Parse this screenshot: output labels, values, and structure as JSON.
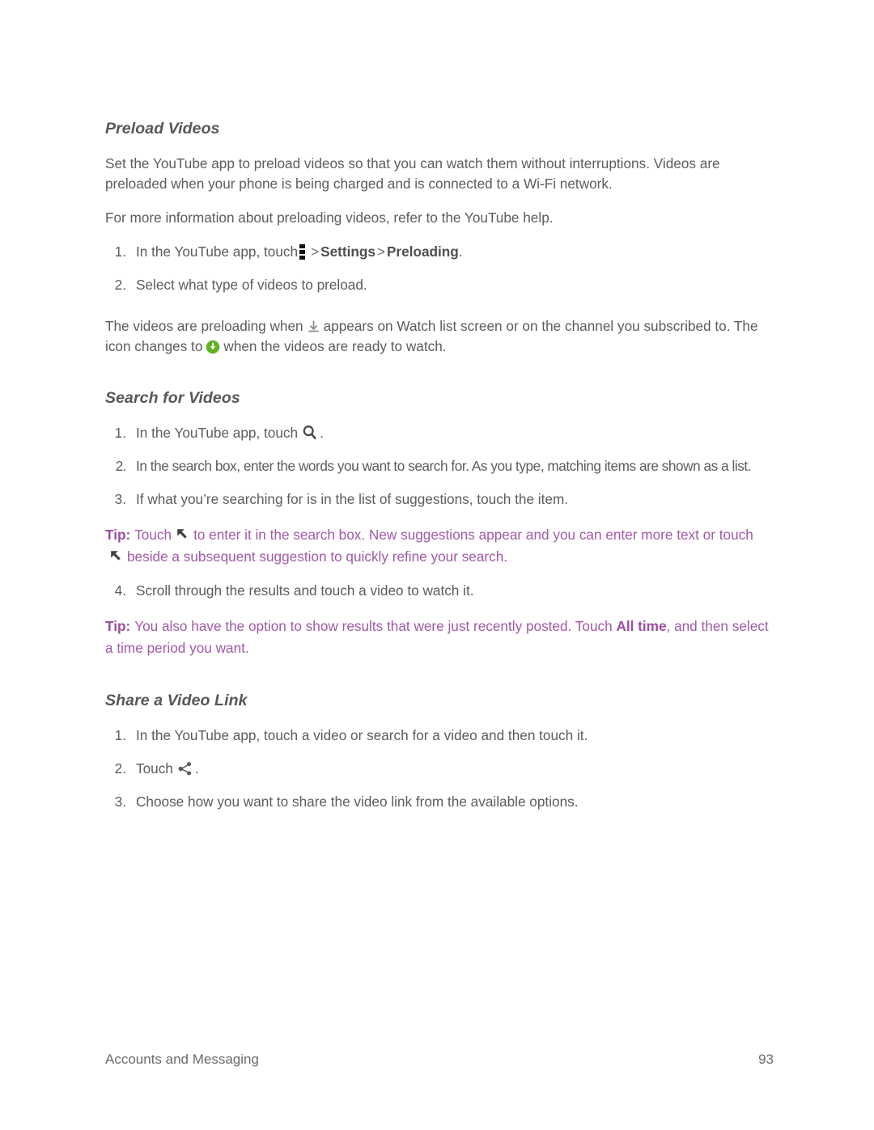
{
  "page": {
    "footer_left": "Accounts and Messaging",
    "footer_page_number": "93"
  },
  "colors": {
    "body_text": "#5c5c5c",
    "heading_text": "#575757",
    "tip_text": "#a05aa6",
    "tip_label": "#9a4f9f",
    "icon_green": "#5fb321",
    "icon_dark": "#4a4a4a",
    "background": "#ffffff"
  },
  "sections": [
    {
      "id": "preload-videos",
      "heading": "Preload Videos",
      "paragraphs": [
        "Set the YouTube app to preload videos so that you can watch them without interruptions. Videos are preloaded when your phone is being charged and is connected to a Wi-Fi network.",
        "For more information about preloading videos, refer to the YouTube help."
      ],
      "steps": [
        {
          "num": "1.",
          "prefix": "In the YouTube app, touch",
          "icon": "overflow-menu-icon",
          "chevron_1": ">",
          "bold_1": "Settings",
          "chevron_2": ">",
          "bold_2": "Preloading",
          "suffix": "."
        },
        {
          "num": "2.",
          "text": "Select what type of videos to preload."
        }
      ],
      "closing": {
        "part_1": "The videos are preloading when",
        "icon_1": "download-icon",
        "part_2": "appears on Watch list screen or on the channel you subscribed to. The icon changes to",
        "icon_2": "download-complete-icon",
        "part_3": "when the videos are ready to watch."
      }
    },
    {
      "id": "search-for-videos",
      "heading": "Search for Videos",
      "steps": [
        {
          "num": "1.",
          "prefix": "In the YouTube app, touch",
          "icon": "search-icon",
          "suffix": "."
        },
        {
          "num": "2.",
          "text": "In the search box, enter the words you want to search for. As you type, matching items are shown as a list."
        },
        {
          "num": "3.",
          "text": "If what you’re searching for is in the list of suggestions, touch the item."
        },
        {
          "num": "4.",
          "text": "Scroll through the results and touch a video to watch it."
        }
      ],
      "tips": [
        {
          "label": "Tip:",
          "part_1": "Touch",
          "icon_1": "arrow-up-left-icon",
          "part_2": "to enter it in the search box. New suggestions appear and you can enter more text or touch",
          "icon_2": "arrow-up-left-icon",
          "part_3": "beside a subsequent suggestion to quickly refine your search."
        },
        {
          "label": "Tip:",
          "part_1": "You also have the option to show results that were just recently posted. Touch",
          "bold_1": "All time",
          "part_2": ", and then select a time period you want."
        }
      ]
    },
    {
      "id": "share-a-video-link",
      "heading": "Share a Video Link",
      "steps": [
        {
          "num": "1.",
          "text": "In the YouTube app, touch a video or search for a video and then touch it."
        },
        {
          "num": "2.",
          "prefix": "Touch",
          "icon": "share-icon",
          "suffix": "."
        },
        {
          "num": "3.",
          "text": "Choose how you want to share the video link from the available options."
        }
      ]
    }
  ]
}
